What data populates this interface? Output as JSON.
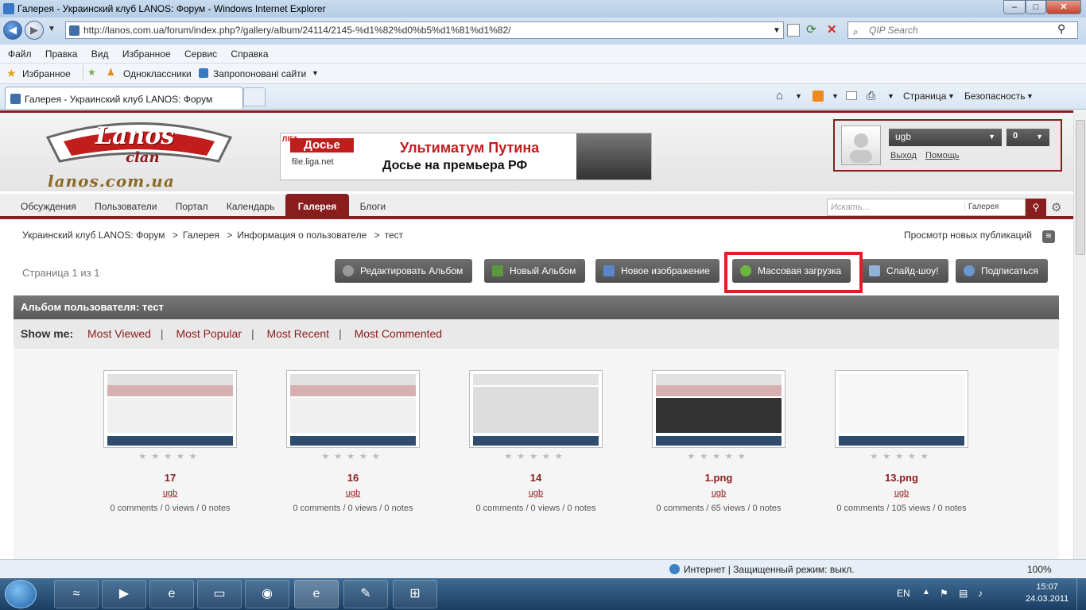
{
  "window": {
    "title": "Галерея - Украинский клуб LANOS: Форум - Windows Internet Explorer",
    "address": "http://lanos.com.ua/forum/index.php?/gallery/album/24114/2145-%d1%82%d0%b5%d1%81%d1%82/",
    "search_placeholder": "QIP Search"
  },
  "menu": [
    "Файл",
    "Правка",
    "Вид",
    "Избранное",
    "Сервис",
    "Справка"
  ],
  "favbar": {
    "favorites": "Избранное",
    "odnoklassniki": "Одноклассники",
    "suggested": "Запропоновані сайти"
  },
  "tab": {
    "label": "Галерея - Украинский клуб LANOS: Форум"
  },
  "commandbar": {
    "page": "Страница",
    "safety": "Безопасность"
  },
  "site": {
    "logo_top": "Lanos",
    "logo_sub": "clan",
    "logo_domain": "lanos.com.ua",
    "banner_brand": "Досье",
    "banner_brand_top": "ЛІГА",
    "banner_source": "file.liga.net",
    "banner_line1": "Ультиматум Путина",
    "banner_line2": "Досье на премьера РФ"
  },
  "user": {
    "name": "ugb",
    "count": "0",
    "logout": "Выход",
    "help": "Помощь"
  },
  "nav": {
    "items": [
      "Обсуждения",
      "Пользователи",
      "Портал",
      "Календарь"
    ],
    "active": "Галерея",
    "blogs": "Блоги",
    "search_placeholder": "Искать...",
    "search_scope": "Галерея"
  },
  "breadcrumb": [
    "Украинский клуб LANOS: Форум",
    "Галерея",
    "Информация о пользователе",
    "тест"
  ],
  "new_pubs": "Просмотр новых публикаций",
  "page_info": "Страница 1 из 1",
  "buttons": {
    "edit_album": "Редактировать Альбом",
    "new_album": "Новый Альбом",
    "new_image": "Новое изображение",
    "mass_upload": "Массовая загрузка",
    "slideshow": "Слайд-шоу!",
    "subscribe": "Подписаться"
  },
  "album": {
    "title": "Альбом пользователя: тест",
    "show_me": "Show me:",
    "filters": [
      "Most Viewed",
      "Most Popular",
      "Most Recent",
      "Most Commented"
    ]
  },
  "images": [
    {
      "title": "17",
      "user": "ugb",
      "meta": "0 comments / 0 views / 0 notes"
    },
    {
      "title": "16",
      "user": "ugb",
      "meta": "0 comments / 0 views / 0 notes"
    },
    {
      "title": "14",
      "user": "ugb",
      "meta": "0 comments / 0 views / 0 notes"
    },
    {
      "title": "1.png",
      "user": "ugb",
      "meta": "0 comments / 65 views / 0 notes"
    },
    {
      "title": "13.png",
      "user": "ugb",
      "meta": "0 comments / 105 views / 0 notes"
    }
  ],
  "status": {
    "zone": "Интернет | Защищенный режим: выкл.",
    "zoom": "100%"
  },
  "taskbar": {
    "lang": "EN",
    "time": "15:07",
    "date": "24.03.2011"
  },
  "colors": {
    "brand": "#8a1d1d",
    "highlight": "#e01c24"
  }
}
